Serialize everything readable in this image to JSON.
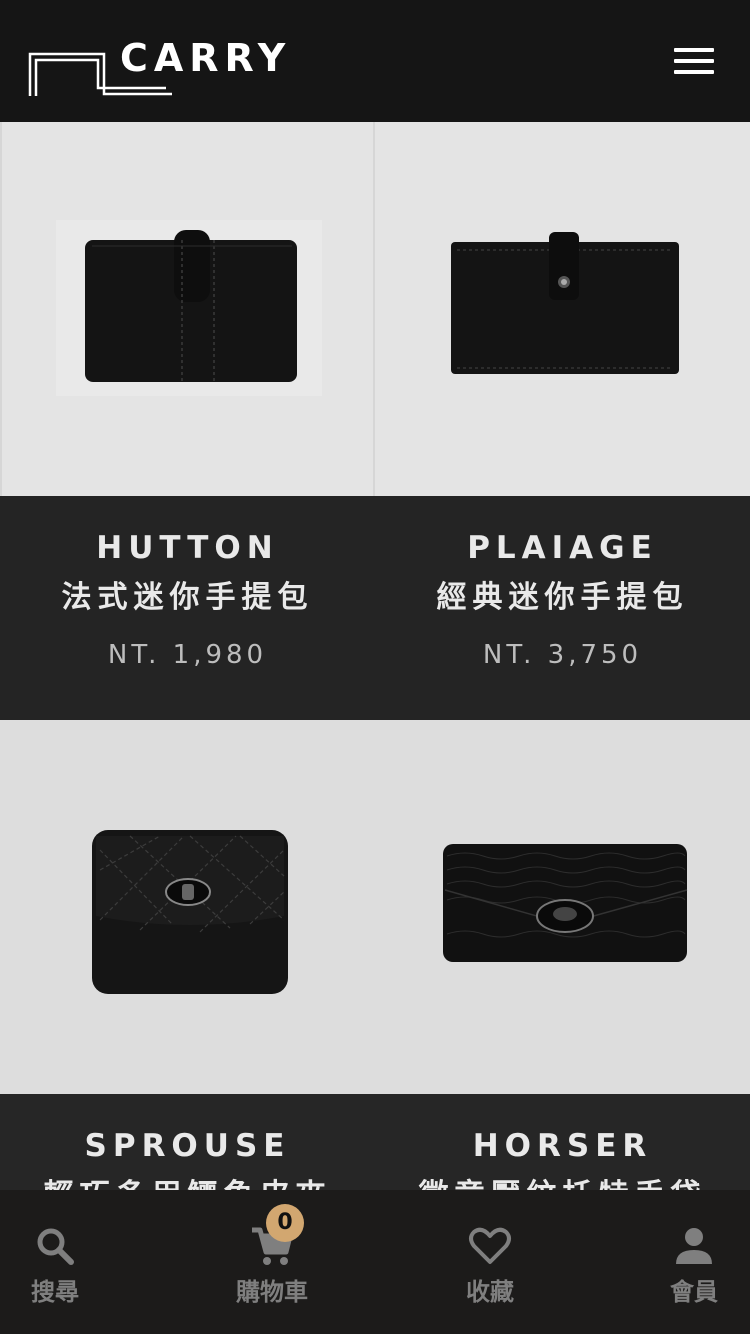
{
  "header": {
    "brand": "CARRY",
    "menu_icon": "hamburger-menu-icon"
  },
  "products": [
    {
      "name": "HUTTON",
      "subtitle": "法式迷你手提包",
      "price": "NT. 1,980",
      "image": "black-leather-wallet-with-strap"
    },
    {
      "name": "PLAIAGE",
      "subtitle": "經典迷你手提包",
      "price": "NT. 3,750",
      "image": "black-long-wallet-with-snap"
    },
    {
      "name": "SPROUSE",
      "subtitle": "輕巧多用鱷魚皮夾",
      "price": "",
      "image": "black-quilted-flap-purse"
    },
    {
      "name": "HORSER",
      "subtitle": "徽章壓紋托特手袋",
      "price": "",
      "image": "black-snakeskin-clutch"
    }
  ],
  "tabbar": {
    "tabs": [
      {
        "label": "搜尋",
        "icon": "search-icon"
      },
      {
        "label": "購物車",
        "icon": "cart-icon"
      },
      {
        "label": "收藏",
        "icon": "heart-icon"
      },
      {
        "label": "會員",
        "icon": "user-icon"
      }
    ],
    "cart_count": "0"
  },
  "colors": {
    "header_bg": "#151515",
    "card_info_bg": "#242424",
    "badge": "#d2a770",
    "tab_label": "#7f7f7f"
  }
}
